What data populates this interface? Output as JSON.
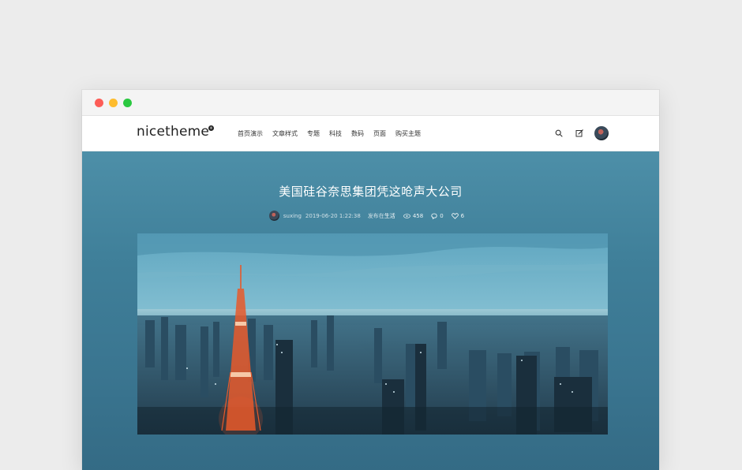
{
  "header": {
    "logo": "nicetheme",
    "logo_badge": "®",
    "menu": [
      {
        "label": "首页演示"
      },
      {
        "label": "文章样式"
      },
      {
        "label": "专题"
      },
      {
        "label": "科技"
      },
      {
        "label": "数码"
      },
      {
        "label": "页面"
      },
      {
        "label": "购买主题"
      }
    ]
  },
  "article": {
    "title": "美国硅谷奈思集团凭这呛声大公司",
    "author": "suxing",
    "date": "2019-06-20 1:22:38",
    "category_prefix": "发布在",
    "category": "生活",
    "views": "458",
    "comments": "0",
    "likes": "6"
  },
  "colors": {
    "hero_bg": "#3f7f99",
    "tower": "#e7592a"
  },
  "icons": [
    "search-icon",
    "edit-icon",
    "eye-icon",
    "comment-icon",
    "heart-icon"
  ]
}
